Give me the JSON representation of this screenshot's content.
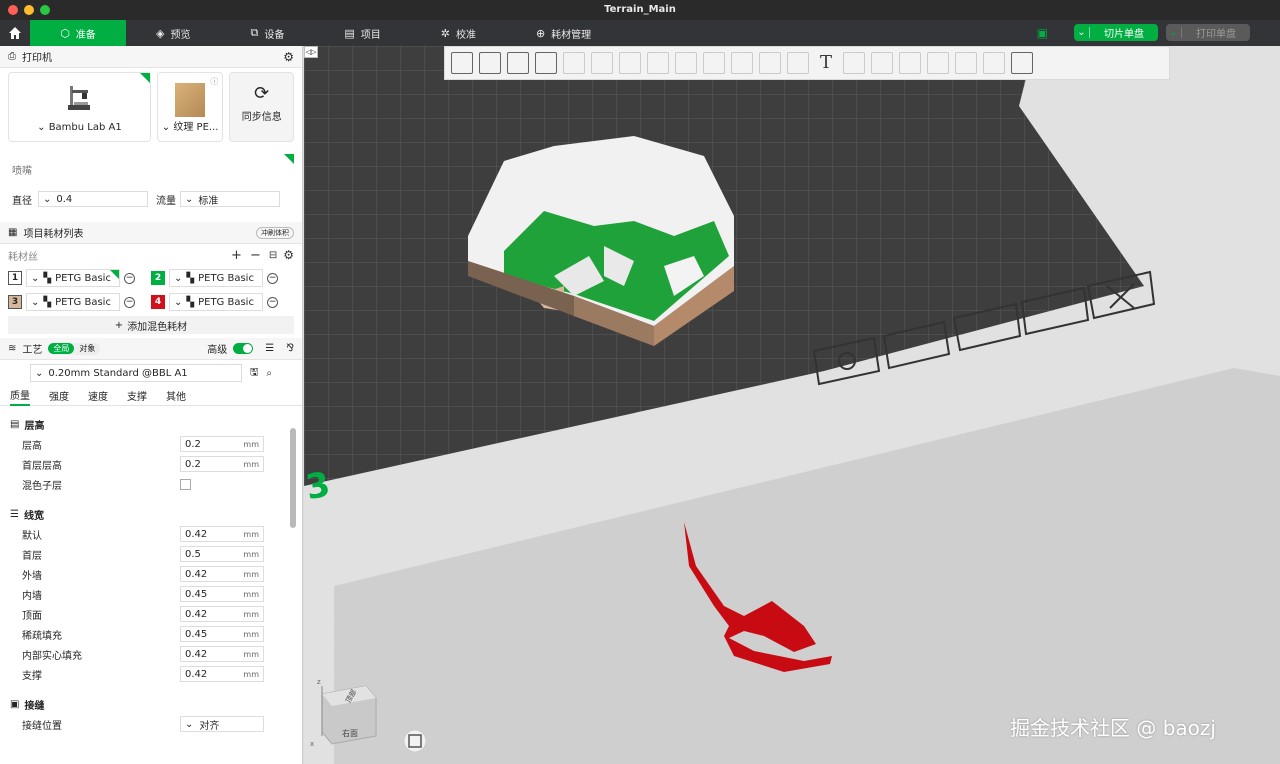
{
  "window": {
    "title": "Terrain_Main"
  },
  "topbar": {
    "tabs": [
      {
        "label": "准备",
        "icon": "cube-icon",
        "active": true
      },
      {
        "label": "预览",
        "icon": "layers-icon"
      },
      {
        "label": "设备",
        "icon": "device-icon"
      },
      {
        "label": "项目",
        "icon": "project-icon"
      },
      {
        "label": "校准",
        "icon": "calibrate-icon"
      },
      {
        "label": "耗材管理",
        "icon": "filament-icon"
      }
    ],
    "slice_label": "切片单盘",
    "print_label": "打印单盘"
  },
  "printer": {
    "section_title": "打印机",
    "printer_name": "Bambu Lab A1",
    "plate_name": "纹理 PE...",
    "sync_label": "同步信息",
    "nozzle_title": "喷嘴",
    "diameter_label": "直径",
    "diameter_value": "0.4",
    "flow_label": "流量",
    "flow_value": "标准"
  },
  "filaments": {
    "section_title": "项目耗材列表",
    "flush_label": "冲刷体积",
    "sub_label": "耗材丝",
    "items": [
      {
        "num": "1",
        "name": "PETG Basic",
        "color": "#ffffff"
      },
      {
        "num": "2",
        "name": "PETG Basic",
        "color": "#00ae42"
      },
      {
        "num": "3",
        "name": "PETG Basic",
        "color": "#d8b89c"
      },
      {
        "num": "4",
        "name": "PETG Basic",
        "color": "#d0101a"
      }
    ],
    "add_mix_label": "添加混色耗材"
  },
  "process": {
    "section_title": "工艺",
    "global_label": "全局",
    "object_label": "对象",
    "advanced_label": "高级",
    "preset": "0.20mm Standard @BBL A1",
    "subtabs": [
      "质量",
      "强度",
      "速度",
      "支撑",
      "其他"
    ],
    "groups": [
      {
        "title": "层高",
        "rows": [
          {
            "label": "层高",
            "value": "0.2",
            "unit": "mm"
          },
          {
            "label": "首层层高",
            "value": "0.2",
            "unit": "mm"
          },
          {
            "label": "混色子层",
            "checkbox": true
          }
        ]
      },
      {
        "title": "线宽",
        "rows": [
          {
            "label": "默认",
            "value": "0.42",
            "unit": "mm"
          },
          {
            "label": "首层",
            "value": "0.5",
            "unit": "mm"
          },
          {
            "label": "外墙",
            "value": "0.42",
            "unit": "mm"
          },
          {
            "label": "内墙",
            "value": "0.45",
            "unit": "mm"
          },
          {
            "label": "顶面",
            "value": "0.42",
            "unit": "mm"
          },
          {
            "label": "稀疏填充",
            "value": "0.45",
            "unit": "mm"
          },
          {
            "label": "内部实心填充",
            "value": "0.42",
            "unit": "mm"
          },
          {
            "label": "支撑",
            "value": "0.42",
            "unit": "mm"
          }
        ]
      },
      {
        "title": "接缝",
        "rows": [
          {
            "label": "接缝位置",
            "value": "对齐",
            "dropdown": true
          }
        ]
      }
    ]
  },
  "viewport": {
    "plate_number": "3",
    "cube_top": "顶部",
    "cube_right": "右面",
    "axis_z": "z",
    "axis_x": "x"
  },
  "watermark": "掘金技术社区 @ baozj"
}
